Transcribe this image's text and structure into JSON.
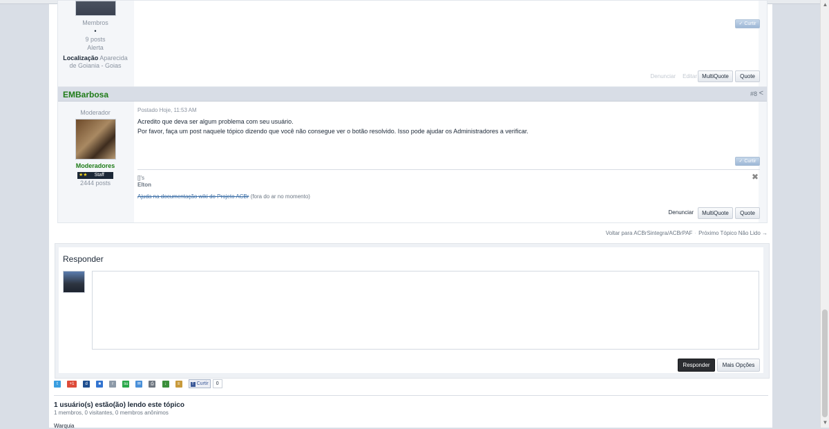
{
  "post1": {
    "group": "Membros",
    "bullet": "•",
    "posts": "9 posts",
    "alert": "Alerta",
    "location_label": "Localização",
    "location_value": "Aparecida de Goiania - Goias",
    "like_label": "Curtir",
    "report_label": "Denunciar",
    "edit_label": "Editar",
    "multiquote_label": "MultiQuote",
    "quote_label": "Quote"
  },
  "post2": {
    "author": "EMBarbosa",
    "post_number": "#8",
    "title": "Moderador",
    "group": "Moderadores",
    "badge_stars": "★★",
    "badge_label": "Staff",
    "posts": "2444 posts",
    "date": "Postado Hoje, 11:53 AM",
    "text_line1": "Acredito que deva ser algum problema com seu usuário.",
    "text_line2": "Por favor, faça um post naquele tópico dizendo que você não consegue ver o botão resolvido. Isso pode ajudar os Administradores a verificar.",
    "like_label": "Curtir",
    "sig_line1": "[]'s",
    "sig_line2": "Elton",
    "sig_link": "Ajuda na documentação wiki do Projeto ACBr",
    "sig_note": "(fora do ar no momento)",
    "report_label": "Denunciar",
    "multiquote_label": "MultiQuote",
    "quote_label": "Quote"
  },
  "nav": {
    "back_label": "Voltar para ACBrSintegra/ACBrPAF",
    "separator": "·",
    "next_label": "Próximo Tópico Não Lido →"
  },
  "reply": {
    "title": "Responder",
    "submit_label": "Responder",
    "more_options_label": "Mais Opções"
  },
  "share": {
    "like_label": "Curtir",
    "like_count": "0"
  },
  "readers": {
    "title": "1 usuário(s) estão(ão) lendo este tópico",
    "subtitle": "1 membros, 0 visitantes, 0 membros anônimos",
    "names": "Warquia"
  }
}
